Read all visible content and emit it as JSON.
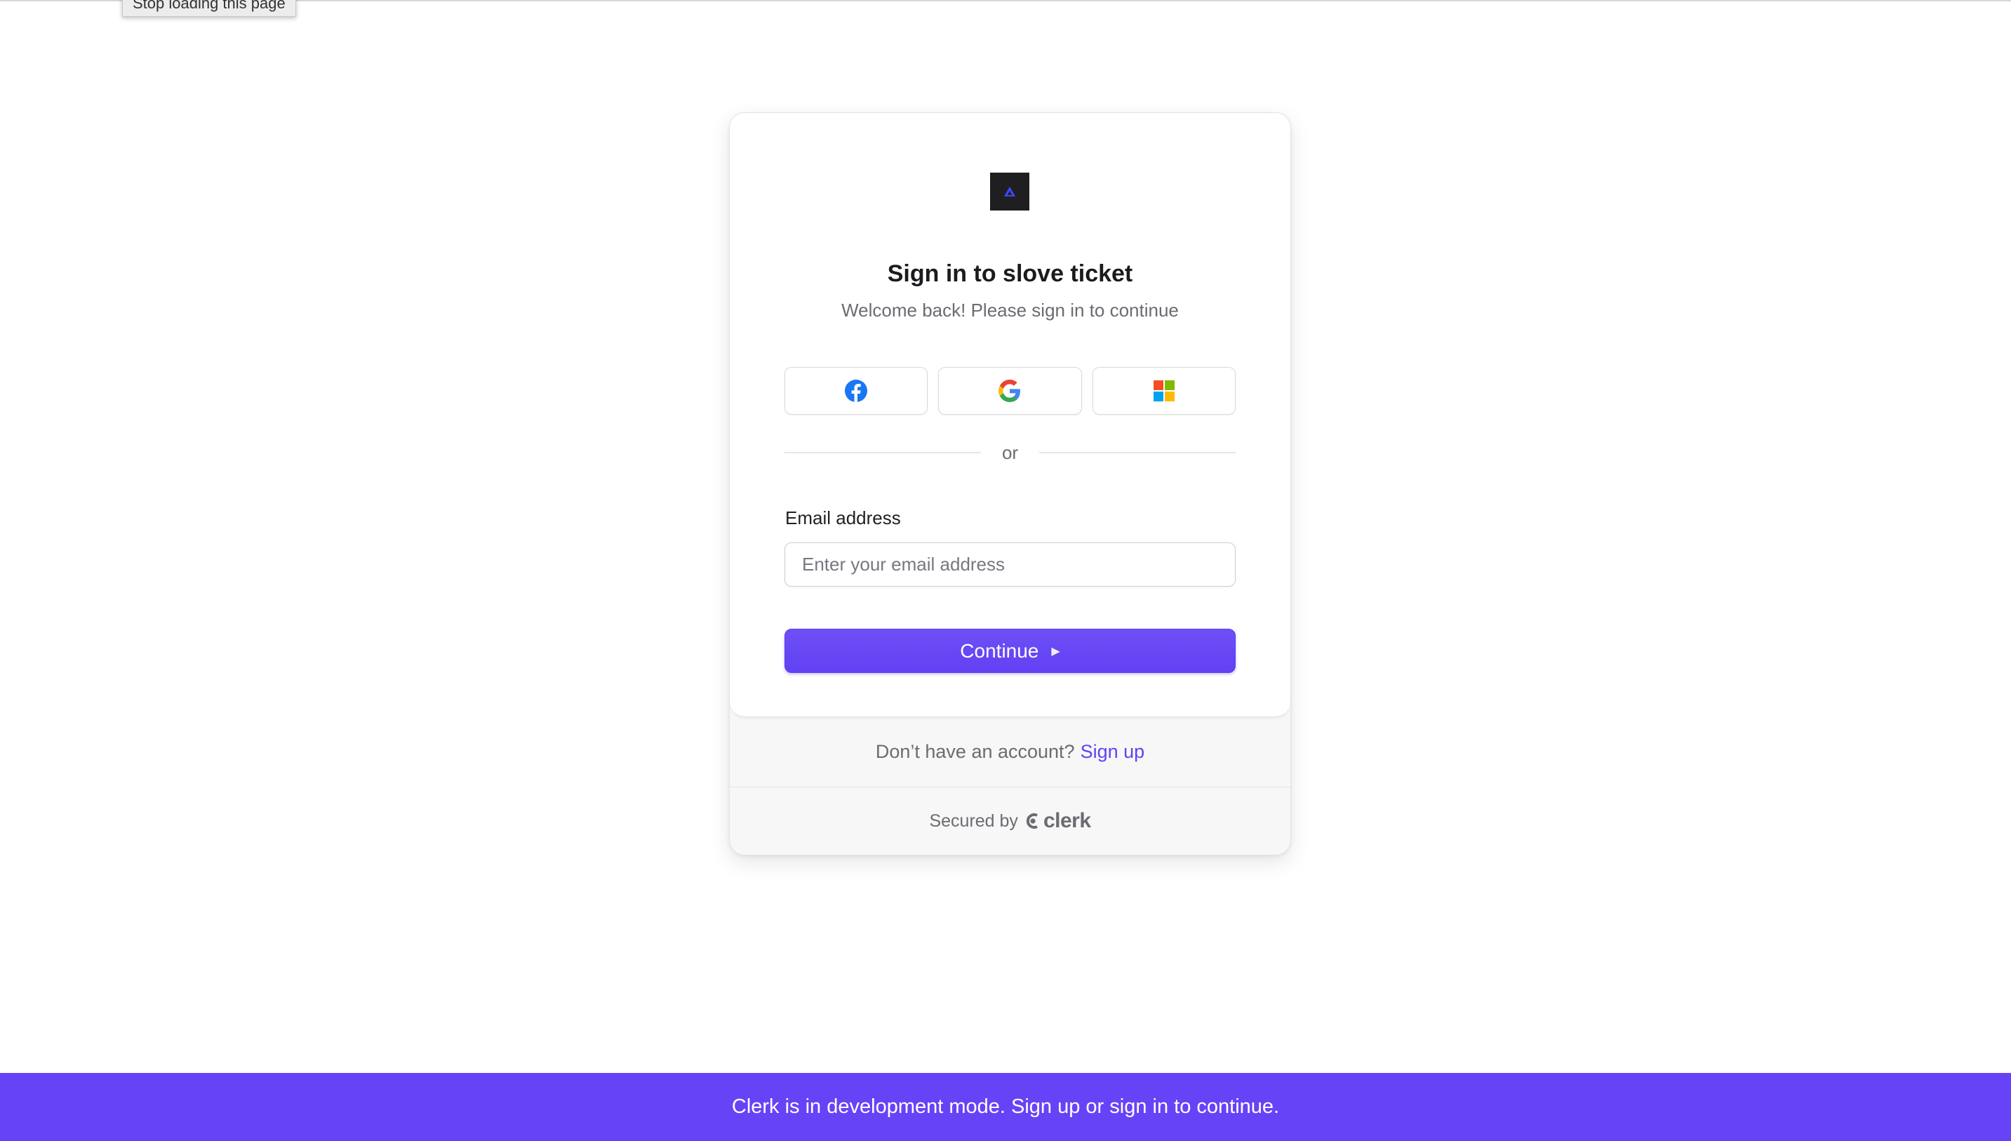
{
  "browser": {
    "tooltip": "Stop loading this page"
  },
  "signin": {
    "title": "Sign in to slove ticket",
    "subtitle": "Welcome back! Please sign in to continue",
    "social": [
      {
        "provider": "facebook",
        "icon": "facebook-icon"
      },
      {
        "provider": "google",
        "icon": "google-icon"
      },
      {
        "provider": "microsoft",
        "icon": "microsoft-icon"
      }
    ],
    "divider": "or",
    "email": {
      "label": "Email address",
      "placeholder": "Enter your email address",
      "value": ""
    },
    "continue_label": "Continue",
    "signup_prompt": "Don’t have an account?",
    "signup_link": "Sign up",
    "secured_by": "Secured by",
    "brand": "clerk"
  },
  "banner": {
    "text": "Clerk is in development mode. Sign up or sign in to continue."
  },
  "colors": {
    "primary": "#6141f2",
    "banner": "#6743f7",
    "logo_bg": "#1f1f22",
    "logo_accent": "#3b4cf5"
  }
}
